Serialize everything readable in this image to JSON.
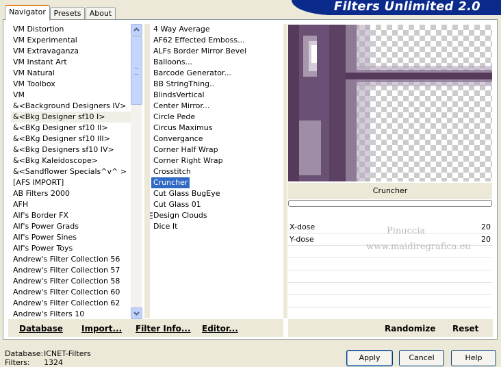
{
  "banner": {
    "title": "Filters Unlimited 2.0"
  },
  "tabs": [
    {
      "label": "Navigator"
    },
    {
      "label": "Presets"
    },
    {
      "label": "About"
    }
  ],
  "categories": {
    "items": [
      "VM Distortion",
      "VM Experimental",
      "VM Extravaganza",
      "VM Instant Art",
      "VM Natural",
      "VM Toolbox",
      "VM",
      "&<Background Designers IV>",
      "&<Bkg Designer sf10 I>",
      "&<BKg Designer sf10 II>",
      "&<BKg Designer sf10 III>",
      "&<Bkg Designers sf10 IV>",
      "&<Bkg Kaleidoscope>",
      "&<Sandflower Specials^v^ >",
      "[AFS IMPORT]",
      "AB Filters 2000",
      "AFH",
      "Alf's Border FX",
      "Alf's Power Grads",
      "Alf's Power Sines",
      "Alf's Power Toys",
      "Andrew's Filter Collection 56",
      "Andrew's Filter Collection 57",
      "Andrew's Filter Collection 58",
      "Andrew's Filter Collection 60",
      "Andrew's Filter Collection 62",
      "Andrew's Filters 10"
    ],
    "selected_index": 8
  },
  "filters": {
    "items": [
      "4 Way Average",
      "AF62 Effected Emboss...",
      "ALFs Border Mirror Bevel",
      "Balloons...",
      "Barcode Generator...",
      "BB StringThing..",
      "BlindsVertical",
      "Center Mirror...",
      "Circle Pede",
      "Circus Maximus",
      "Convergance",
      "Corner Half Wrap",
      "Corner Right Wrap",
      "Crosstitch",
      "Cruncher",
      "Cut Glass  BugEye",
      "Cut Glass 01",
      "Design Clouds",
      "Dice It"
    ],
    "selected_index": 14
  },
  "preview": {
    "filter_name": "Cruncher",
    "progress": 0
  },
  "params": [
    {
      "label": "X-dose",
      "value": "20"
    },
    {
      "label": "Y-dose",
      "value": "20"
    }
  ],
  "watermark": {
    "line1": "Pinuccia",
    "line2": "www.maidiregrafica.eu"
  },
  "toolbar": {
    "database": "Database",
    "import": "Import...",
    "filter_info": "Filter Info...",
    "editor": "Editor...",
    "randomize": "Randomize",
    "reset": "Reset"
  },
  "status": {
    "database_label": "Database:",
    "database_value": "ICNET-Filters",
    "filters_label": "Filters:",
    "filters_value": "1324"
  },
  "buttons": {
    "apply": "Apply",
    "cancel": "Cancel",
    "help": "Help"
  },
  "colors": {
    "accent": "#316ac5",
    "banner": "#0a2a8c",
    "preview_purple": "#553a5c"
  }
}
